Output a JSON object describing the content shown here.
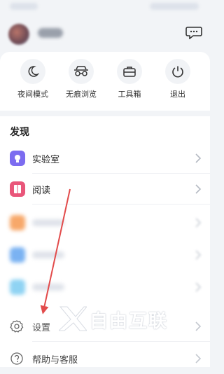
{
  "toolbar": {
    "items": [
      {
        "label": "夜间模式",
        "icon": "moon-icon"
      },
      {
        "label": "无痕浏览",
        "icon": "incognito-glasses-icon"
      },
      {
        "label": "工具箱",
        "icon": "toolbox-icon"
      },
      {
        "label": "退出",
        "icon": "power-icon"
      }
    ]
  },
  "discover": {
    "title": "发现",
    "items": [
      {
        "label": "实验室",
        "icon": "lab-icon",
        "color": "#7c6cf0"
      },
      {
        "label": "阅读",
        "icon": "book-icon",
        "color": "#e9567a"
      }
    ]
  },
  "menu": {
    "settings_label": "设置",
    "help_label": "帮助与客服"
  },
  "watermark": {
    "text": "自由互联"
  },
  "colors": {
    "accent_red": "#e24b4b",
    "lab": "#7c6cf0",
    "read": "#e9567a"
  }
}
